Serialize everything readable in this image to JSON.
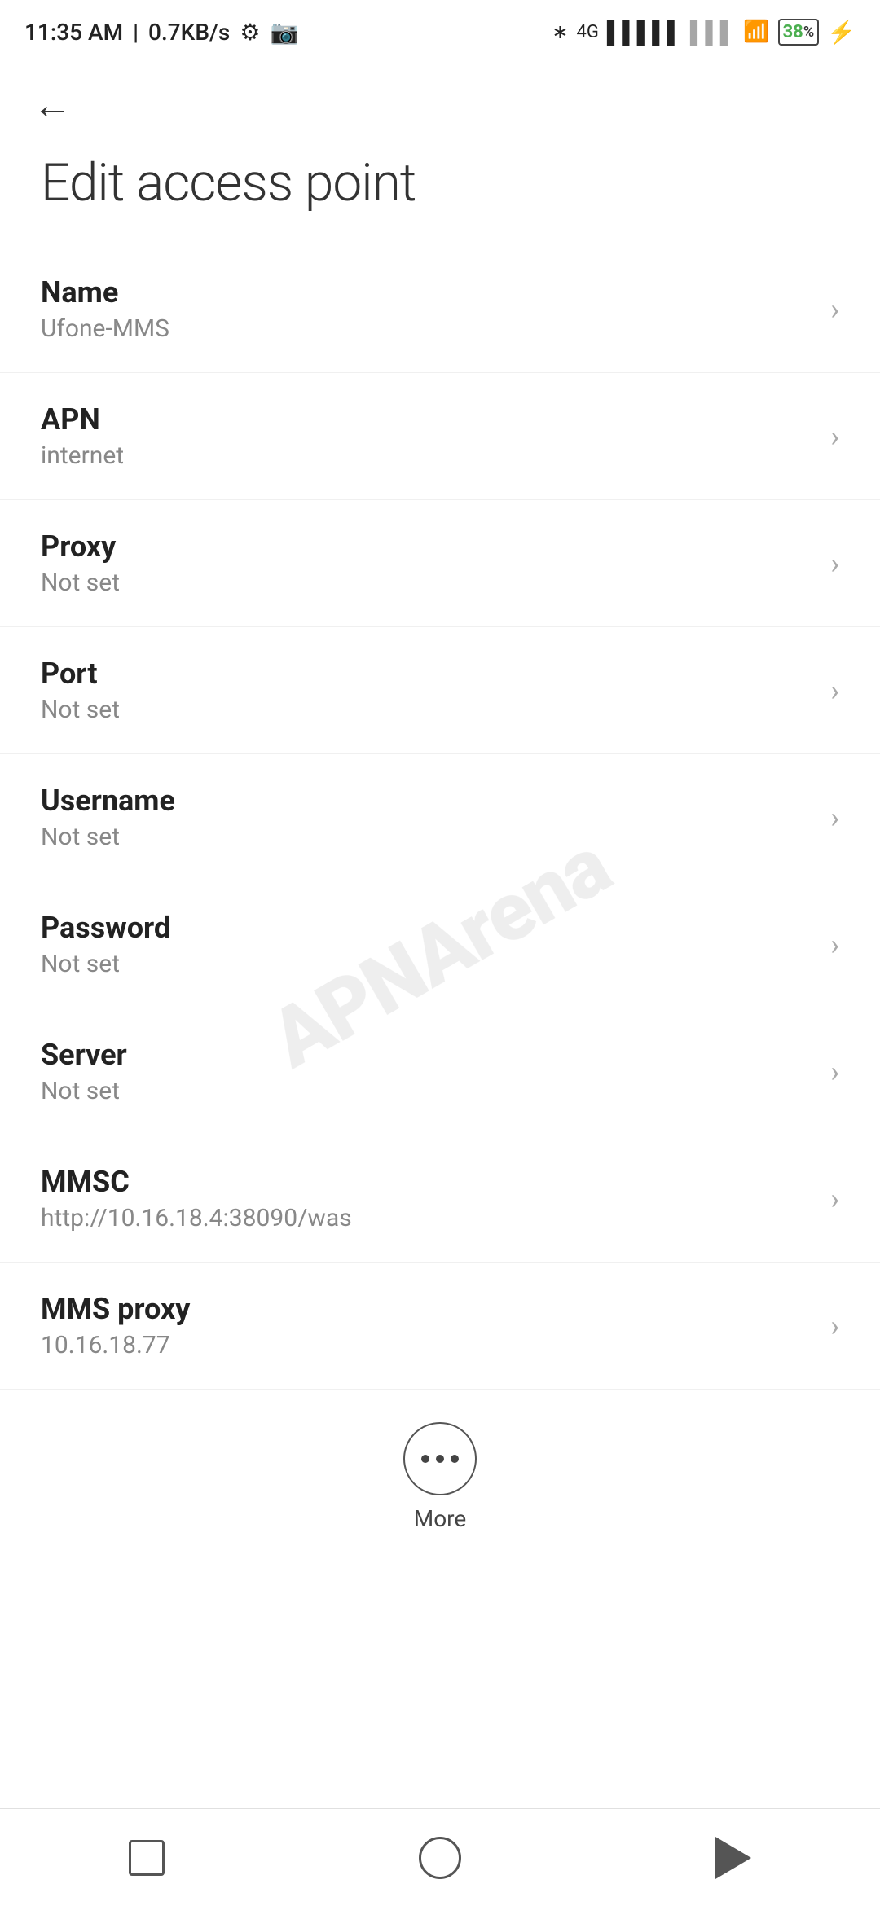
{
  "statusBar": {
    "time": "11:35 AM",
    "speed": "0.7KB/s"
  },
  "page": {
    "title": "Edit access point",
    "backLabel": "Back"
  },
  "settings": [
    {
      "label": "Name",
      "value": "Ufone-MMS"
    },
    {
      "label": "APN",
      "value": "internet"
    },
    {
      "label": "Proxy",
      "value": "Not set"
    },
    {
      "label": "Port",
      "value": "Not set"
    },
    {
      "label": "Username",
      "value": "Not set"
    },
    {
      "label": "Password",
      "value": "Not set"
    },
    {
      "label": "Server",
      "value": "Not set"
    },
    {
      "label": "MMSC",
      "value": "http://10.16.18.4:38090/was"
    },
    {
      "label": "MMS proxy",
      "value": "10.16.18.77"
    }
  ],
  "more": {
    "label": "More"
  },
  "watermark": "APNArena"
}
